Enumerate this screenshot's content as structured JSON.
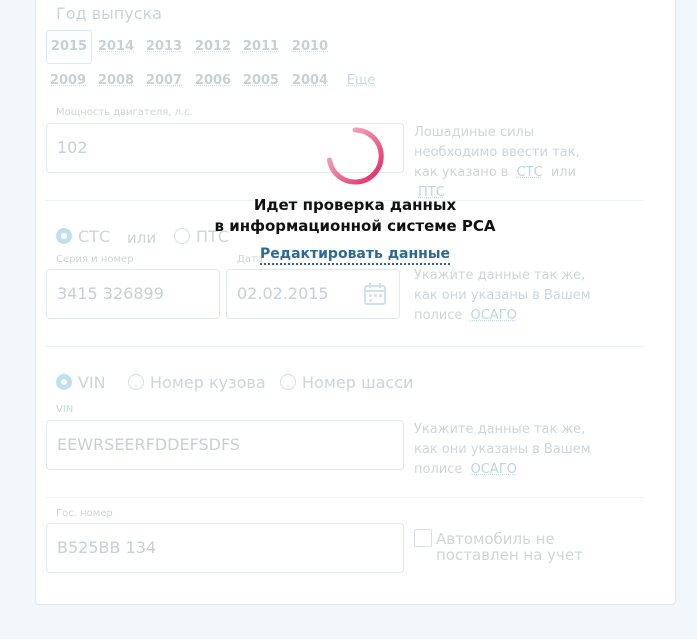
{
  "form": {
    "year_title": "Год выпуска",
    "years_row1": [
      "2015",
      "2014",
      "2013",
      "2012",
      "2011",
      "2010"
    ],
    "years_row2": [
      "2009",
      "2008",
      "2007",
      "2006",
      "2005",
      "2004"
    ],
    "more": "Еще",
    "power_label": "Мощность двигателя, л.с.",
    "power_value": "102",
    "power_hint_text": "Лошадиные силы необходимо ввести так, как указано в",
    "power_hint_link1": "СТС",
    "power_hint_or": "или",
    "power_hint_link2": "ПТС",
    "doc_radio1": "СТС",
    "doc_or": "или",
    "doc_radio2": "ПТС",
    "series_label": "Серия и номер",
    "series_value": "3415 326899",
    "date_label": "Дата",
    "date_value": "02.02.2015",
    "doc_hint_text": "Укажите данные так же, как они указаны в Вашем полисе",
    "doc_hint_link": "ОСАГО",
    "id_radio1": "VIN",
    "id_radio2": "Номер кузова",
    "id_radio3": "Номер шасси",
    "vin_label": "VIN",
    "vin_value": "EEWRSEERFDDEFSDFS",
    "vin_hint_text": "Укажите данные так же, как они указаны в Вашем полисе",
    "vin_hint_link": "ОСАГО",
    "plate_label": "Гос. номер",
    "plate_value": "В525ВВ 134",
    "unregistered_label": "Автомобиль не поставлен на учет"
  },
  "overlay": {
    "title_line1": "Идет проверка данных",
    "title_line2": "в информационной системе РСА",
    "edit_link": "Редактировать данные",
    "spinner_color_start": "#f7c6d6",
    "spinner_color_end": "#e0245e"
  }
}
